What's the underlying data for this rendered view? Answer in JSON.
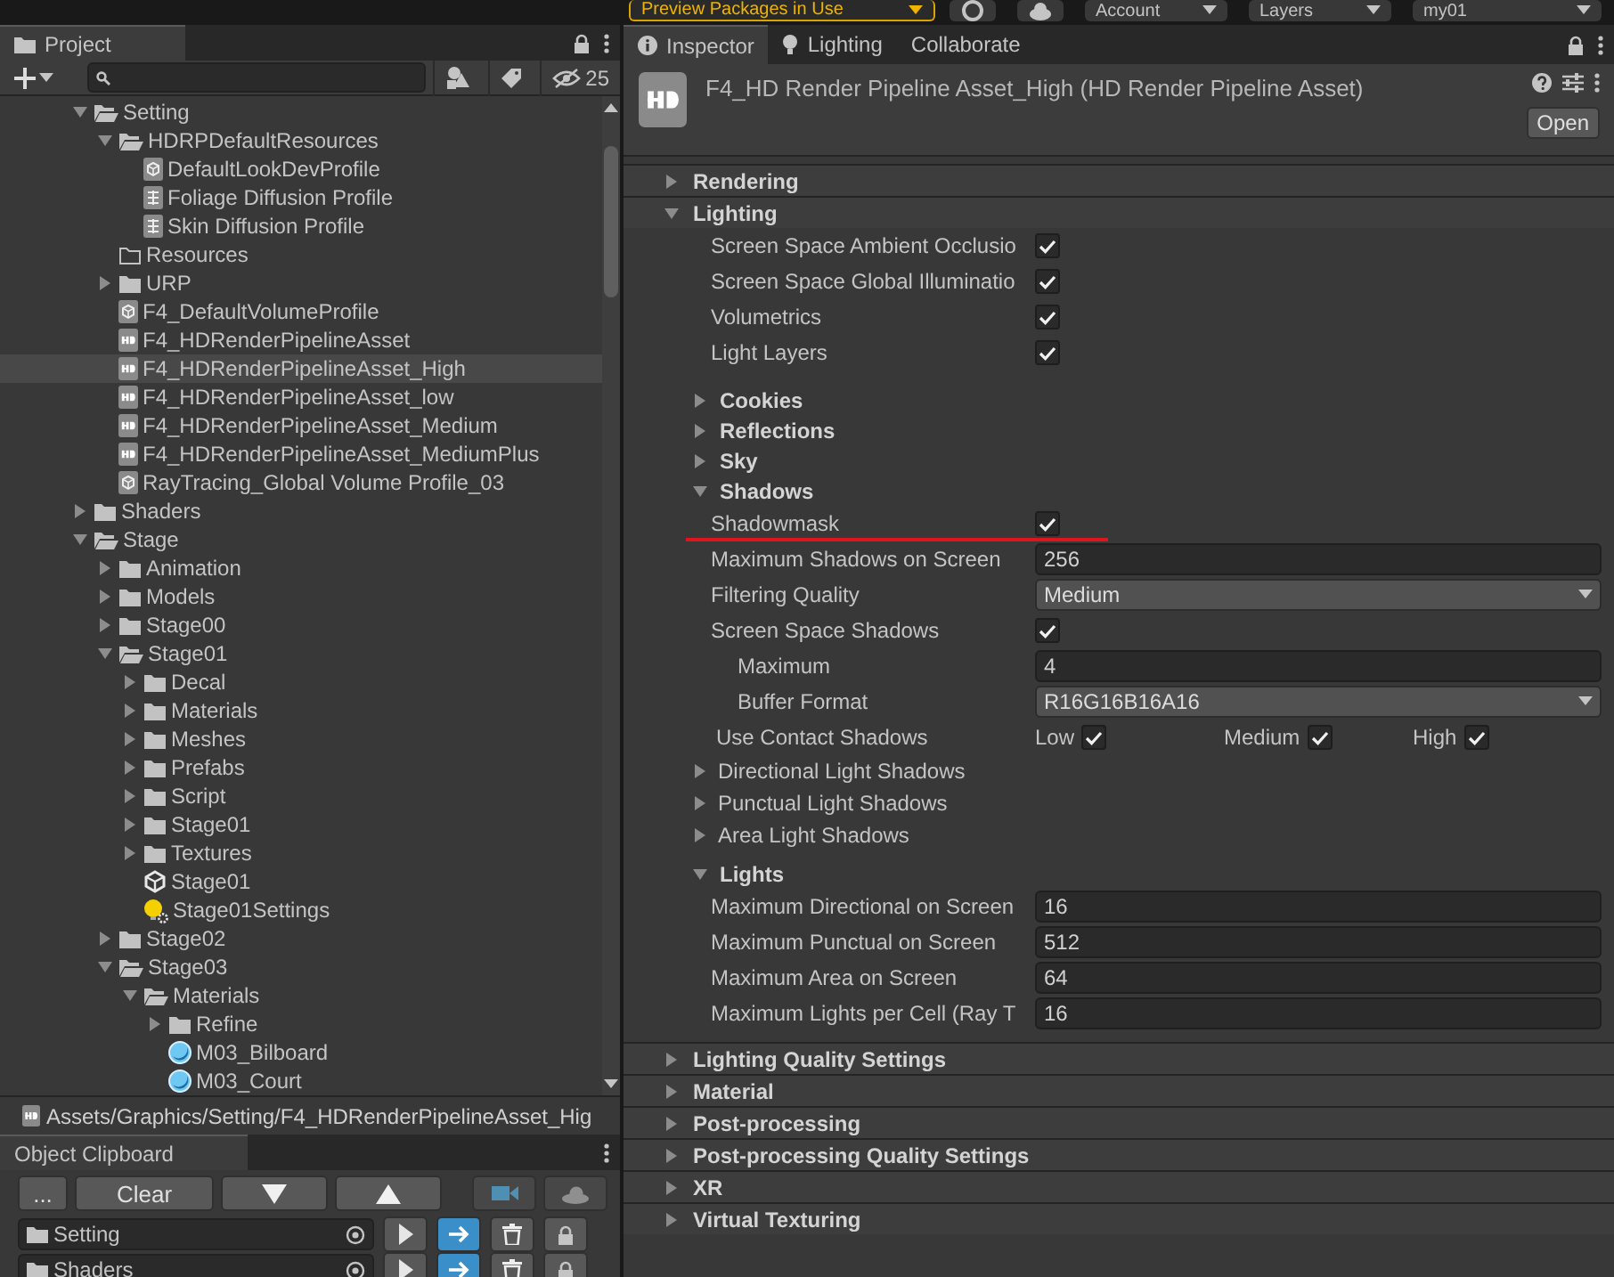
{
  "toolbar": {
    "preview_packages": "Preview Packages in Use",
    "account": "Account",
    "layers": "Layers",
    "layout": "my01"
  },
  "project": {
    "tab": "Project",
    "hidden_count": "25",
    "tree": [
      {
        "label": "Setting",
        "kind": "folder",
        "expanded": true,
        "selected": false,
        "children": [
          {
            "label": "HDRPDefaultResources",
            "kind": "folder",
            "expanded": true,
            "selected": false,
            "children": [
              {
                "label": "DefaultLookDevProfile",
                "kind": "volume",
                "selected": false
              },
              {
                "label": "Foliage Diffusion Profile",
                "kind": "diffusion",
                "selected": false
              },
              {
                "label": "Skin Diffusion Profile",
                "kind": "diffusion",
                "selected": false
              }
            ]
          },
          {
            "label": "Resources",
            "kind": "folder-empty",
            "selected": false
          },
          {
            "label": "URP",
            "kind": "folder",
            "expanded": false,
            "selected": false
          },
          {
            "label": "F4_DefaultVolumeProfile",
            "kind": "volume",
            "selected": false
          },
          {
            "label": "F4_HDRenderPipelineAsset",
            "kind": "asset",
            "selected": false
          },
          {
            "label": "F4_HDRenderPipelineAsset_High",
            "kind": "asset",
            "selected": true
          },
          {
            "label": "F4_HDRenderPipelineAsset_low",
            "kind": "asset",
            "selected": false
          },
          {
            "label": "F4_HDRenderPipelineAsset_Medium",
            "kind": "asset",
            "selected": false
          },
          {
            "label": "F4_HDRenderPipelineAsset_MediumPlus",
            "kind": "asset",
            "selected": false
          },
          {
            "label": "RayTracing_Global Volume Profile_03",
            "kind": "volume",
            "selected": false
          }
        ]
      },
      {
        "label": "Shaders",
        "kind": "folder",
        "expanded": false,
        "selected": false
      },
      {
        "label": "Stage",
        "kind": "folder",
        "expanded": true,
        "selected": false,
        "children": [
          {
            "label": "Animation",
            "kind": "folder",
            "expanded": false,
            "selected": false
          },
          {
            "label": "Models",
            "kind": "folder",
            "expanded": false,
            "selected": false
          },
          {
            "label": "Stage00",
            "kind": "folder",
            "expanded": false,
            "selected": false
          },
          {
            "label": "Stage01",
            "kind": "folder",
            "expanded": true,
            "selected": false,
            "children": [
              {
                "label": "Decal",
                "kind": "folder",
                "expanded": false,
                "selected": false
              },
              {
                "label": "Materials",
                "kind": "folder",
                "expanded": false,
                "selected": false
              },
              {
                "label": "Meshes",
                "kind": "folder",
                "expanded": false,
                "selected": false
              },
              {
                "label": "Prefabs",
                "kind": "folder",
                "expanded": false,
                "selected": false
              },
              {
                "label": "Script",
                "kind": "folder",
                "expanded": false,
                "selected": false
              },
              {
                "label": "Stage01",
                "kind": "folder",
                "expanded": false,
                "selected": false
              },
              {
                "label": "Textures",
                "kind": "folder",
                "expanded": false,
                "selected": false
              },
              {
                "label": "Stage01",
                "kind": "scene",
                "selected": false
              },
              {
                "label": "Stage01Settings",
                "kind": "lighting",
                "selected": false
              }
            ]
          },
          {
            "label": "Stage02",
            "kind": "folder",
            "expanded": false,
            "selected": false
          },
          {
            "label": "Stage03",
            "kind": "folder",
            "expanded": true,
            "selected": false,
            "children": [
              {
                "label": "Materials",
                "kind": "folder",
                "expanded": true,
                "selected": false,
                "children": [
                  {
                    "label": "Refine",
                    "kind": "folder",
                    "expanded": false,
                    "selected": false
                  },
                  {
                    "label": "M03_Bilboard",
                    "kind": "material",
                    "selected": false
                  },
                  {
                    "label": "M03_Court",
                    "kind": "material",
                    "selected": false
                  }
                ]
              }
            ]
          }
        ]
      }
    ],
    "path": "Assets/Graphics/Setting/F4_HDRenderPipelineAsset_Hig"
  },
  "clipboard": {
    "title": "Object Clipboard",
    "buttons": [
      {
        "kind": "text",
        "label": "..."
      },
      {
        "kind": "text",
        "label": "Clear"
      },
      {
        "kind": "down"
      },
      {
        "kind": "up"
      },
      {
        "kind": "camera"
      },
      {
        "kind": "cloud"
      }
    ],
    "entries": [
      {
        "label": "Setting"
      },
      {
        "label": "Shaders"
      }
    ]
  },
  "inspector": {
    "tabs": [
      {
        "label": "Inspector",
        "kind": "info",
        "selected": true
      },
      {
        "label": "Lighting",
        "kind": "bulb",
        "selected": false
      },
      {
        "label": "Collaborate",
        "kind": "none",
        "selected": false
      }
    ],
    "title": "F4_HD Render Pipeline Asset_High (HD Render Pipeline Asset)",
    "open_button": "Open",
    "sections": [
      {
        "title": "Rendering",
        "expanded": false
      },
      {
        "title": "Lighting",
        "expanded": true,
        "rows": [
          {
            "kind": "checkbox",
            "label": "Screen Space Ambient Occlusio",
            "checked": true
          },
          {
            "kind": "checkbox",
            "label": "Screen Space Global Illuminatio",
            "checked": true
          },
          {
            "kind": "checkbox",
            "label": "Volumetrics",
            "checked": true
          },
          {
            "kind": "checkbox",
            "label": "Light Layers",
            "checked": true
          },
          {
            "kind": "subsection",
            "label": "Cookies",
            "expanded": false
          },
          {
            "kind": "subsection",
            "label": "Reflections",
            "expanded": false
          },
          {
            "kind": "subsection",
            "label": "Sky",
            "expanded": false
          },
          {
            "kind": "subsection",
            "label": "Shadows",
            "expanded": true
          },
          {
            "kind": "checkbox",
            "label": "Shadowmask",
            "checked": true,
            "underlined": true
          },
          {
            "kind": "number",
            "label": "Maximum Shadows on Screen",
            "value": "256"
          },
          {
            "kind": "dropdown",
            "label": "Filtering Quality",
            "value": "Medium"
          },
          {
            "kind": "checkbox",
            "label": "Screen Space Shadows",
            "checked": true
          },
          {
            "kind": "number",
            "label": "Maximum",
            "value": "4",
            "nested": true
          },
          {
            "kind": "dropdown",
            "label": "Buffer Format",
            "value": "R16G16B16A16",
            "nested": true
          },
          {
            "kind": "levels",
            "label": "Use Contact Shadows",
            "options": [
              {
                "label": "Low",
                "checked": true
              },
              {
                "label": "Medium",
                "checked": true
              },
              {
                "label": "High",
                "checked": true
              }
            ]
          },
          {
            "kind": "foldout",
            "label": "Directional Light Shadows",
            "expanded": false
          },
          {
            "kind": "foldout",
            "label": "Punctual Light Shadows",
            "expanded": false
          },
          {
            "kind": "foldout",
            "label": "Area Light Shadows",
            "expanded": false
          },
          {
            "kind": "subsection",
            "label": "Lights",
            "expanded": true
          },
          {
            "kind": "number",
            "label": "Maximum Directional on Screen",
            "value": "16"
          },
          {
            "kind": "number",
            "label": "Maximum Punctual on Screen",
            "value": "512"
          },
          {
            "kind": "number",
            "label": "Maximum Area on Screen",
            "value": "64"
          },
          {
            "kind": "number",
            "label": "Maximum Lights per Cell (Ray T",
            "value": "16"
          }
        ]
      },
      {
        "title": "Lighting Quality Settings",
        "expanded": false
      },
      {
        "title": "Material",
        "expanded": false
      },
      {
        "title": "Post-processing",
        "expanded": false
      },
      {
        "title": "Post-processing Quality Settings",
        "expanded": false
      },
      {
        "title": "XR",
        "expanded": false
      },
      {
        "title": "Virtual Texturing",
        "expanded": false
      }
    ]
  }
}
